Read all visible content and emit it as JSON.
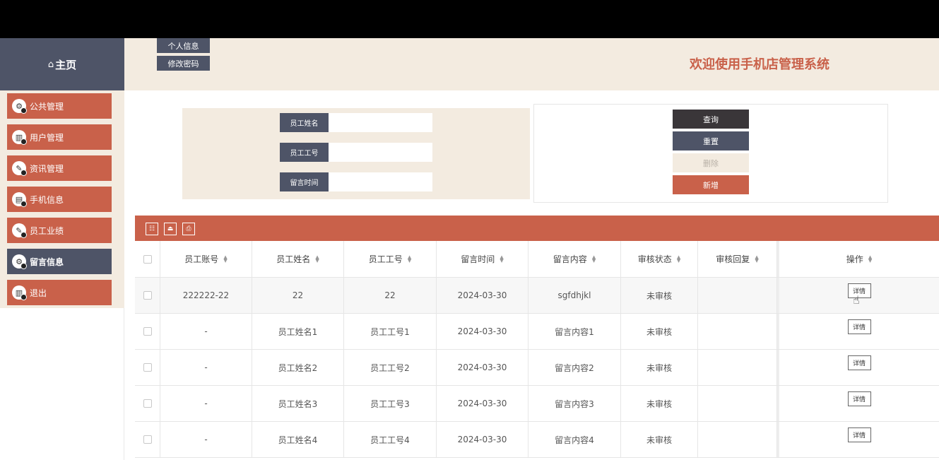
{
  "logo": {
    "icon": "home-icon",
    "icon_glyph": "⌂",
    "label": "主页"
  },
  "header": {
    "personal_info": "个人信息",
    "change_password": "修改密码",
    "title": "欢迎使用手机店管理系统"
  },
  "sidebar": {
    "items": [
      {
        "label": "公共管理",
        "icon": "settings-icon",
        "active": false
      },
      {
        "label": "用户管理",
        "icon": "chart-icon",
        "active": false
      },
      {
        "label": "资讯管理",
        "icon": "edit-icon",
        "active": false
      },
      {
        "label": "手机信息",
        "icon": "clipboard-icon",
        "active": false
      },
      {
        "label": "员工业绩",
        "icon": "edit-icon",
        "active": false
      },
      {
        "label": "留言信息",
        "icon": "settings-icon",
        "active": true
      },
      {
        "label": "退出",
        "icon": "chart-icon",
        "active": false
      }
    ]
  },
  "search": {
    "fields": [
      {
        "label": "员工姓名",
        "value": ""
      },
      {
        "label": "员工工号",
        "value": ""
      },
      {
        "label": "留言时间",
        "value": ""
      }
    ]
  },
  "actions": {
    "query": "查询",
    "reset": "重置",
    "delete": "删除",
    "add": "新增"
  },
  "toolbar": {
    "tools": [
      "filter-icon",
      "export-icon",
      "print-icon"
    ]
  },
  "table": {
    "columns": [
      "员工账号",
      "员工姓名",
      "员工工号",
      "留言时间",
      "留言内容",
      "审核状态",
      "审核回复",
      "操作"
    ],
    "rows": [
      [
        "222222-22",
        "22",
        "22",
        "2024-03-30",
        "sgfdhjkl",
        "未审核",
        "",
        "详情"
      ],
      [
        "-",
        "员工姓名1",
        "员工工号1",
        "2024-03-30",
        "留言内容1",
        "未审核",
        "",
        "详情"
      ],
      [
        "-",
        "员工姓名2",
        "员工工号2",
        "2024-03-30",
        "留言内容2",
        "未审核",
        "",
        "详情"
      ],
      [
        "-",
        "员工姓名3",
        "员工工号3",
        "2024-03-30",
        "留言内容3",
        "未审核",
        "",
        "详情"
      ],
      [
        "-",
        "员工姓名4",
        "员工工号4",
        "2024-03-30",
        "留言内容4",
        "未审核",
        "",
        "详情"
      ]
    ]
  },
  "colors": {
    "brand": "#c9614a",
    "nav_dark": "#4e5467",
    "panel_bg": "#f3ebe0"
  }
}
